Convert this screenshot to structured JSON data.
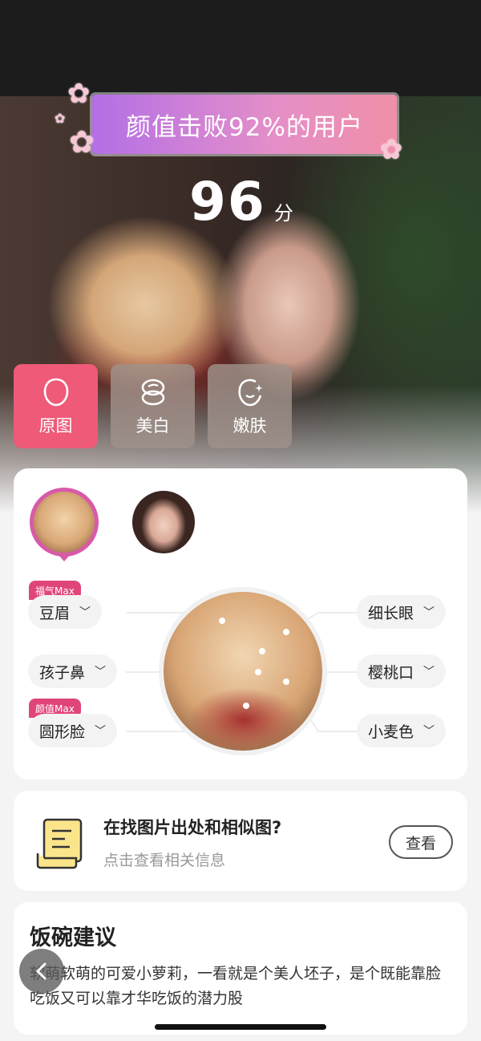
{
  "banner": {
    "text": "颜值击败92%的用户"
  },
  "score": {
    "value": "96",
    "unit": "分"
  },
  "filters": [
    {
      "label": "原图",
      "icon": "face-outline-icon",
      "active": true
    },
    {
      "label": "美白",
      "icon": "compact-mirror-icon",
      "active": false
    },
    {
      "label": "嫩肤",
      "icon": "sparkle-face-icon",
      "active": false
    }
  ],
  "features": {
    "left": [
      {
        "label": "豆眉",
        "tag": "福气Max"
      },
      {
        "label": "孩子鼻",
        "tag": ""
      },
      {
        "label": "圆形脸",
        "tag": "颜值Max"
      }
    ],
    "right": [
      {
        "label": "细长眼"
      },
      {
        "label": "樱桃口"
      },
      {
        "label": "小麦色"
      }
    ]
  },
  "source": {
    "title": "在找图片出处和相似图?",
    "subtitle": "点击查看相关信息",
    "button": "查看"
  },
  "advice": {
    "title": "饭碗建议",
    "text": "软萌软萌的可爱小萝莉，一看就是个美人坯子，是个既能靠脸吃饭又可以靠才华吃饭的潜力股"
  },
  "colors": {
    "accent": "#ee5a78",
    "tag": "#e0457a",
    "ring": "#d85aa9"
  }
}
